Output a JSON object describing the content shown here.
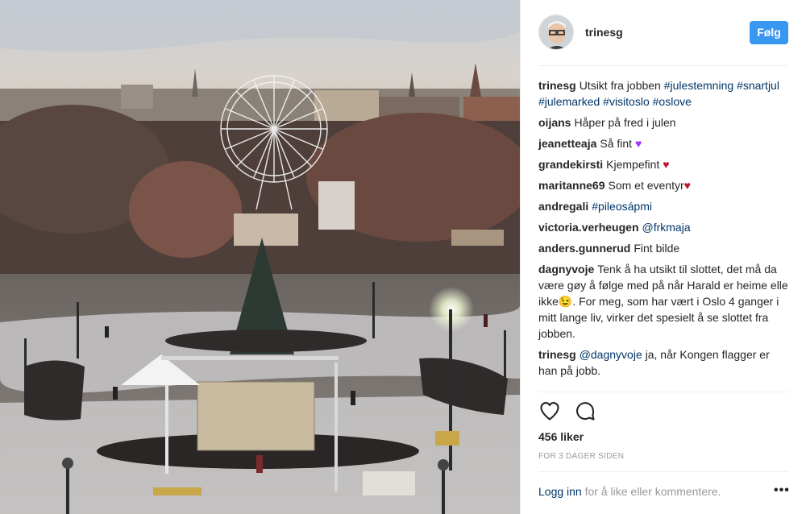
{
  "post": {
    "username": "trinesg",
    "follow_label": "Følg",
    "likes": "456 liker",
    "timestamp": "FOR 3 DAGER SIDEN"
  },
  "comments": [
    {
      "user": "trinesg",
      "parts": [
        {
          "t": "Utsikt fra jobben "
        },
        {
          "t": "#julestemning",
          "tag": true
        },
        {
          "t": " "
        },
        {
          "t": "#snartjul",
          "tag": true
        },
        {
          "t": " "
        },
        {
          "t": "#julemarked",
          "tag": true
        },
        {
          "t": " "
        },
        {
          "t": "#visitoslo",
          "tag": true
        },
        {
          "t": " "
        },
        {
          "t": "#oslove",
          "tag": true
        }
      ]
    },
    {
      "user": "oijans",
      "parts": [
        {
          "t": "Håper på fred i julen"
        }
      ]
    },
    {
      "user": "jeanetteaja",
      "parts": [
        {
          "t": "Så fint "
        },
        {
          "t": "♥",
          "cls": "heart-purple"
        }
      ]
    },
    {
      "user": "grandekirsti",
      "parts": [
        {
          "t": "Kjempefint "
        },
        {
          "t": "♥",
          "cls": "heart-red"
        }
      ]
    },
    {
      "user": "maritanne69",
      "parts": [
        {
          "t": "Som et eventyr"
        },
        {
          "t": "♥",
          "cls": "heart-red"
        }
      ]
    },
    {
      "user": "andregali",
      "parts": [
        {
          "t": "#pileosápmi",
          "tag": true
        }
      ]
    },
    {
      "user": "victoria.verheugen",
      "parts": [
        {
          "t": "@frkmaja",
          "tag": true
        }
      ]
    },
    {
      "user": "anders.gunnerud",
      "parts": [
        {
          "t": "Fint bilde"
        }
      ]
    },
    {
      "user": "dagnyvoje",
      "parts": [
        {
          "t": "Tenk å ha utsikt til slottet, det må da være gøy å følge med på når Harald er heime elle ikke😉. For meg, som har vært i Oslo 4 ganger i mitt lange liv, virker det spesielt å se slottet fra jobben."
        }
      ]
    },
    {
      "user": "trinesg",
      "parts": [
        {
          "t": "@dagnyvoje",
          "tag": true
        },
        {
          "t": " ja, når Kongen flagger er han på jobb."
        }
      ]
    }
  ],
  "footer": {
    "login_link": "Logg inn",
    "login_rest": " for å like eller kommentere.",
    "more": "•••"
  },
  "icons": {
    "like": "heart-outline-icon",
    "comment": "speech-bubble-icon",
    "more": "more-dots-icon"
  },
  "colors": {
    "follow_button": "#3897f0",
    "link": "#003569",
    "muted": "#999999"
  }
}
